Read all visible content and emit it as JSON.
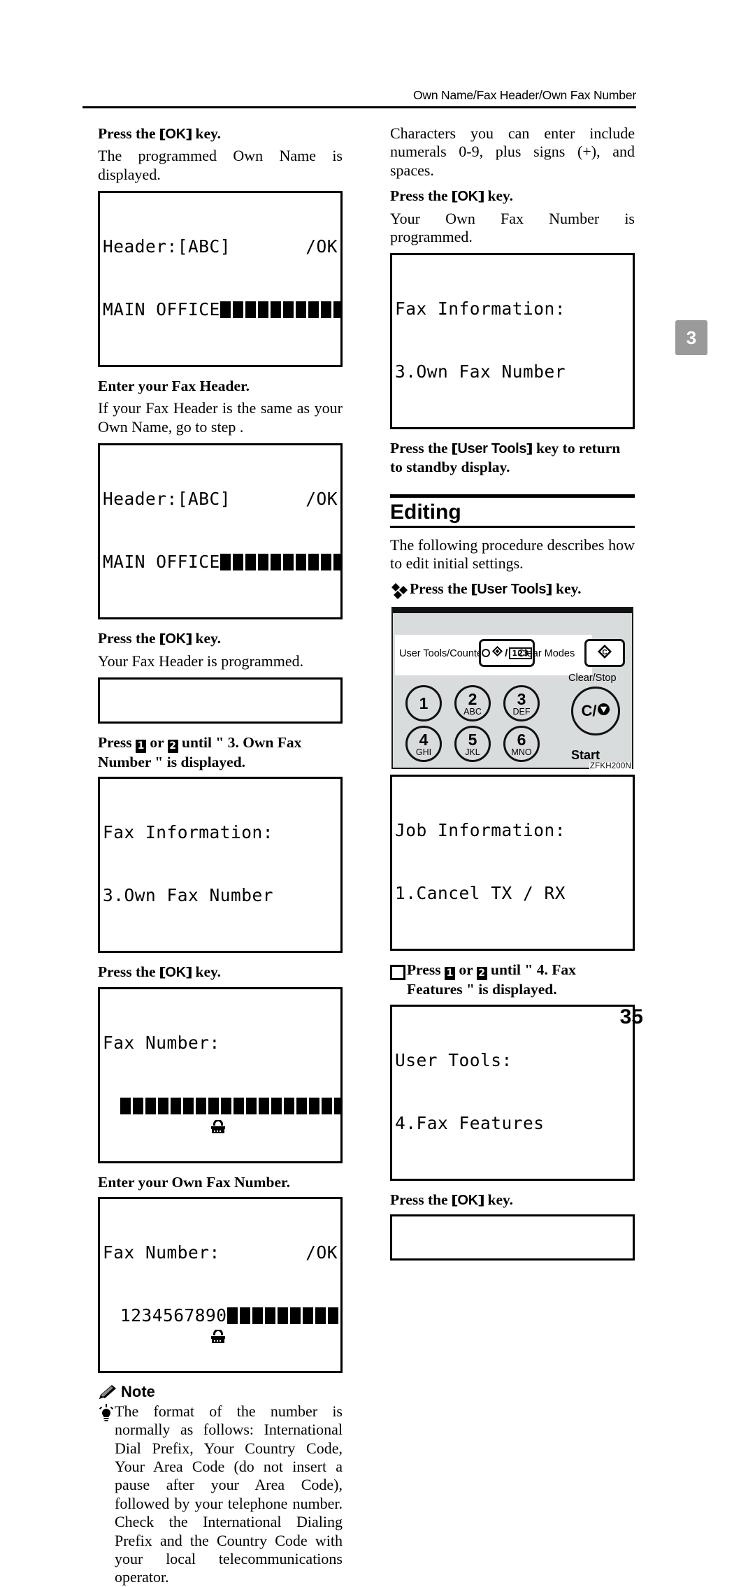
{
  "header": {
    "running_head": "Own Name/Fax Header/Own Fax Number",
    "thumb_tab": "3"
  },
  "folio": "35",
  "left_column": {
    "step1_head_pre": "Press the",
    "step1_head_key": "OK",
    "step1_head_post": "key.",
    "step1_body": "The programmed Own Name is displayed.",
    "lcd1": {
      "line1_left": "Header:[ABC]",
      "line1_right": "/OK",
      "line2_text": "MAIN OFFICE",
      "line2_blocks": 11
    },
    "step2_head": "Enter your Fax Header.",
    "step2_body": "If your Fax Header is the same as your Own Name, go to step    .",
    "lcd2": {
      "line1_left": "Header:[ABC]",
      "line1_right": "/OK",
      "line2_text": "MAIN OFFICE",
      "line2_blocks": 11
    },
    "step3_head_pre": "Press the",
    "step3_head_key": "OK",
    "step3_head_post": "key.",
    "step3_body": "Your Fax Header is programmed.",
    "lcd3_blank": "",
    "step4_head_pre": "Press",
    "step4_key_a": "1",
    "step4_mid": "or",
    "step4_key_b": "2",
    "step4_head_post": "until \" 3. Own Fax Number \" is displayed.",
    "lcd4": {
      "line1": "Fax Information:",
      "line2": "3.Own Fax Number",
      "arrow": "left-right-arrow"
    },
    "step5_head_pre": "Press the",
    "step5_head_key": "OK",
    "step5_head_post": "key.",
    "lcd5": {
      "line1": "Fax Number:",
      "line2_icon": "phone-icon",
      "line2_blocks": 18
    },
    "step6_head": "Enter your Own Fax Number.",
    "lcd6": {
      "line1_left": "Fax Number:",
      "line1_right": "/OK",
      "line2_icon": "phone-icon",
      "line2_text": "1234567890",
      "line2_blocks": 9
    },
    "note_label": "Note",
    "note_text": "The format of the number is normally as follows: International Dial Prefix, Your Country Code, Your Area Code (do not insert a pause after your Area Code), followed by your telephone number. Check the International Dialing Prefix and the Country Code with your local telecommunications operator."
  },
  "right_column": {
    "intro_body": "Characters you can enter include numerals 0-9, plus signs (+), and spaces.",
    "step1_head_pre": "Press the",
    "step1_head_key": "OK",
    "step1_head_post": "key.",
    "step1_body": "Your Own Fax Number is programmed.",
    "lcd1": {
      "line1": "Fax Information:",
      "line2": "3.Own Fax Number",
      "arrow": "left-right-arrow"
    },
    "step2_head_pre": "Press the",
    "step2_head_key": "User Tools",
    "step2_head_post": "key to return to standby display.",
    "section_title": "Editing",
    "section_body": "The following procedure describes how to edit initial settings.",
    "bullet1_pre": "Press the",
    "bullet1_key": "User Tools",
    "bullet1_post": "key.",
    "panel": {
      "user_tools_label": "User Tools/Counter",
      "clear_modes_label": "Clear Modes",
      "clear_stop_label": "Clear/Stop",
      "clear_stop_key": "C/",
      "start_label": "Start",
      "key_123": "123",
      "keys": [
        {
          "digit": "1",
          "letters": ""
        },
        {
          "digit": "2",
          "letters": "ABC"
        },
        {
          "digit": "3",
          "letters": "DEF"
        },
        {
          "digit": "4",
          "letters": "GHI"
        },
        {
          "digit": "5",
          "letters": "JKL"
        },
        {
          "digit": "6",
          "letters": "MNO"
        }
      ],
      "figure_code": "ZFKH200N"
    },
    "lcd2": {
      "line1": "Job Information:",
      "line2": "1.Cancel TX / RX",
      "arrow": "left-right-arrow"
    },
    "step3_head_pre": "Press",
    "step3_key_a": "1",
    "step3_mid": "or",
    "step3_key_b": "2",
    "step3_head_post": "until \" 4. Fax Features \" is displayed.",
    "lcd3": {
      "line1": "User Tools:",
      "line2": "4.Fax Features",
      "arrow": "left-right-arrow"
    },
    "step4_head_pre": "Press the",
    "step4_head_key": "OK",
    "step4_head_post": "key.",
    "lcd4_blank": ""
  }
}
